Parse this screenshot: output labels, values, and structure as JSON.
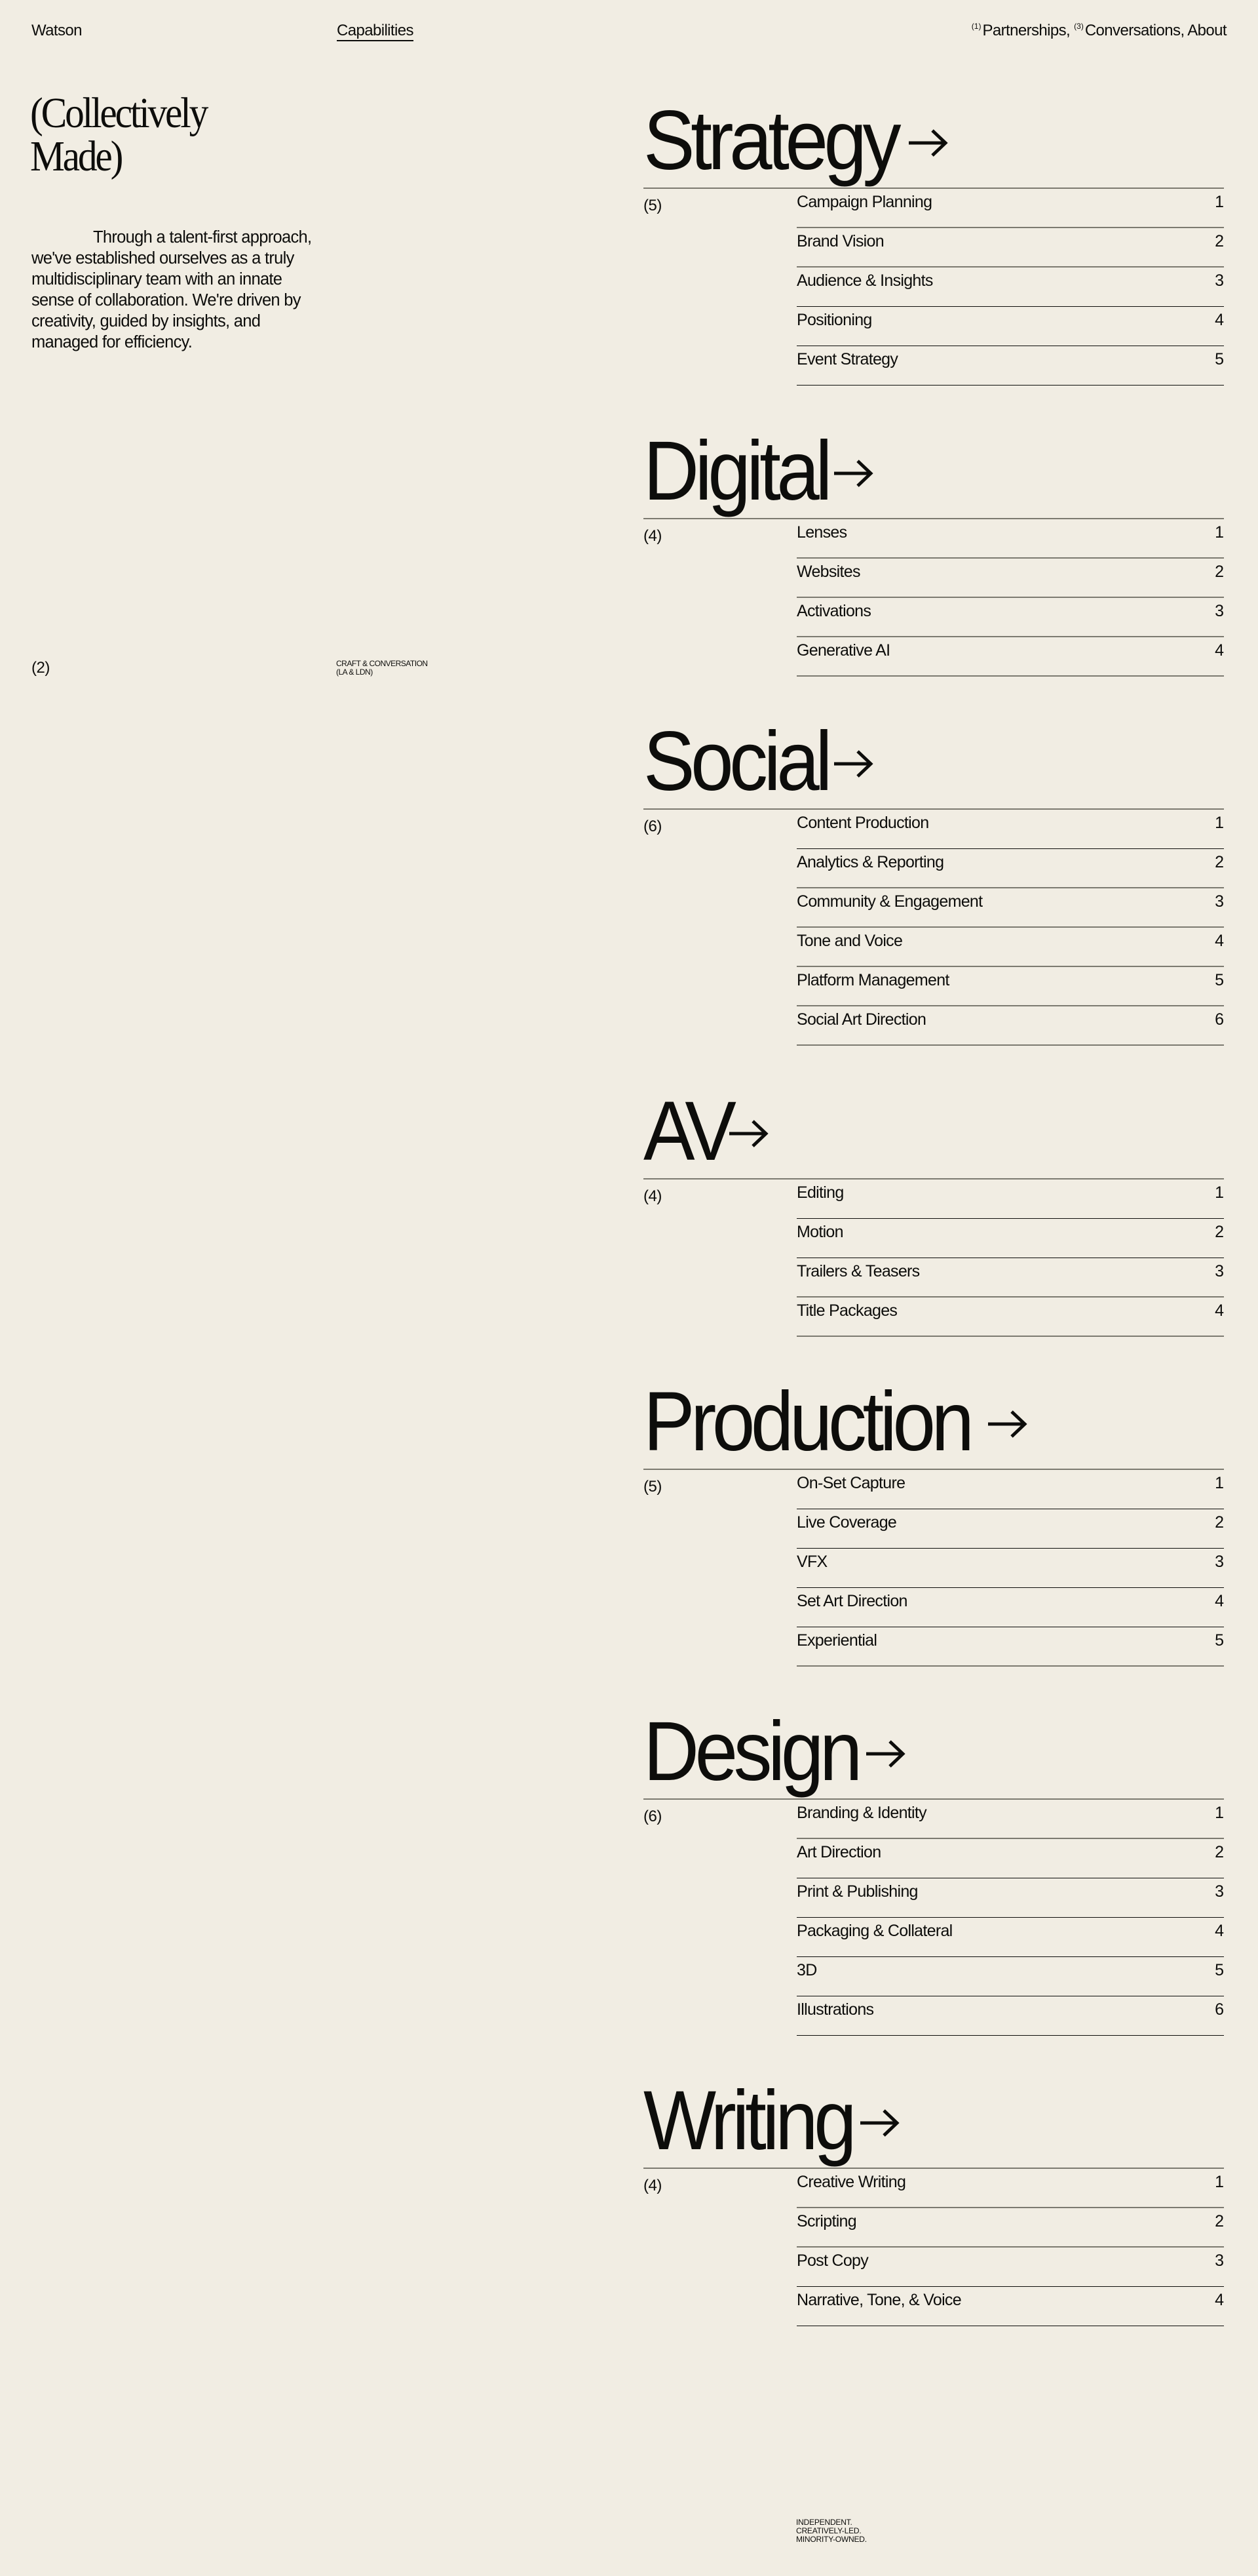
{
  "header": {
    "brand": "Watson",
    "active_nav": "Capabilities",
    "nav_right": [
      {
        "sup": "(1)",
        "label": "Partnerships,"
      },
      {
        "sup": "(3)",
        "label": "Conversations,"
      },
      {
        "sup": "",
        "label": "About"
      }
    ]
  },
  "hero": {
    "title_line1": "(Collectively",
    "title_line2": "Made)",
    "intro": "Through a talent-first approach, we've established ourselves as a truly multidisciplinary team with an innate sense of collaboration. We're driven by creativity, guided by insights, and managed for efficiency.",
    "page_index": "(2)",
    "tagline_line1": "CRAFT & CONVERSATION",
    "tagline_line2": "(LA & LDN)"
  },
  "arrow_icon": "arrow-right-icon",
  "sections": [
    {
      "title": "Strategy",
      "count": "(5)",
      "items": [
        {
          "label": "Campaign Planning",
          "num": "1"
        },
        {
          "label": "Brand Vision",
          "num": "2"
        },
        {
          "label": "Audience & Insights",
          "num": "3"
        },
        {
          "label": "Positioning",
          "num": "4"
        },
        {
          "label": "Event Strategy",
          "num": "5"
        }
      ]
    },
    {
      "title": "Digital",
      "count": "(4)",
      "items": [
        {
          "label": "Lenses",
          "num": "1"
        },
        {
          "label": "Websites",
          "num": "2"
        },
        {
          "label": "Activations",
          "num": "3"
        },
        {
          "label": "Generative AI",
          "num": "4"
        }
      ]
    },
    {
      "title": "Social",
      "count": "(6)",
      "items": [
        {
          "label": "Content Production",
          "num": "1"
        },
        {
          "label": "Analytics & Reporting",
          "num": "2"
        },
        {
          "label": "Community & Engagement",
          "num": "3"
        },
        {
          "label": "Tone and Voice",
          "num": "4"
        },
        {
          "label": "Platform Management",
          "num": "5"
        },
        {
          "label": "Social Art Direction",
          "num": "6"
        }
      ]
    },
    {
      "title": "AV",
      "count": "(4)",
      "items": [
        {
          "label": "Editing",
          "num": "1"
        },
        {
          "label": "Motion",
          "num": "2"
        },
        {
          "label": "Trailers & Teasers",
          "num": "3"
        },
        {
          "label": "Title Packages",
          "num": "4"
        }
      ]
    },
    {
      "title": "Production",
      "count": "(5)",
      "items": [
        {
          "label": "On-Set Capture",
          "num": "1"
        },
        {
          "label": "Live Coverage",
          "num": "2"
        },
        {
          "label": "VFX",
          "num": "3"
        },
        {
          "label": "Set Art Direction",
          "num": "4"
        },
        {
          "label": "Experiential",
          "num": "5"
        }
      ]
    },
    {
      "title": "Design",
      "count": "(6)",
      "items": [
        {
          "label": "Branding & Identity",
          "num": "1"
        },
        {
          "label": "Art Direction",
          "num": "2"
        },
        {
          "label": "Print & Publishing",
          "num": "3"
        },
        {
          "label": "Packaging & Collateral",
          "num": "4"
        },
        {
          "label": "3D",
          "num": "5"
        },
        {
          "label": "Illustrations",
          "num": "6"
        }
      ]
    },
    {
      "title": "Writing",
      "count": "(4)",
      "items": [
        {
          "label": "Creative Writing",
          "num": "1"
        },
        {
          "label": "Scripting",
          "num": "2"
        },
        {
          "label": "Post Copy",
          "num": "3"
        },
        {
          "label": "Narrative, Tone, & Voice",
          "num": "4"
        }
      ]
    }
  ],
  "footer": {
    "line1": "INDEPENDENT.",
    "line2": "CREATIVELY-LED.",
    "line3": "MINORITY-OWNED."
  }
}
